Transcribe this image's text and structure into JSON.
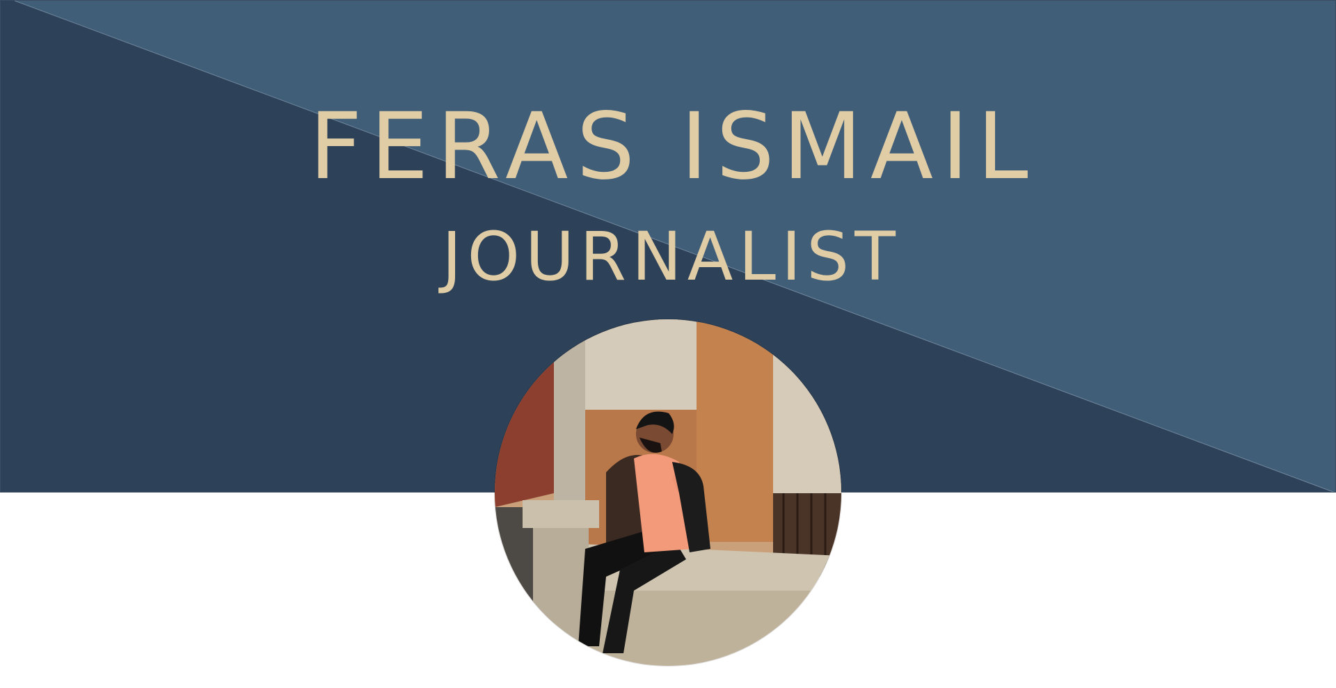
{
  "header": {
    "name": "FERAS ISMAIL",
    "title": "JOURNALIST"
  },
  "colors": {
    "hero_dark": "#2d4158",
    "hero_light": "#405e78",
    "title_text": "#e0cda6",
    "page_background": "#ffffff"
  },
  "portrait": {
    "alt": "portrait-photo"
  }
}
